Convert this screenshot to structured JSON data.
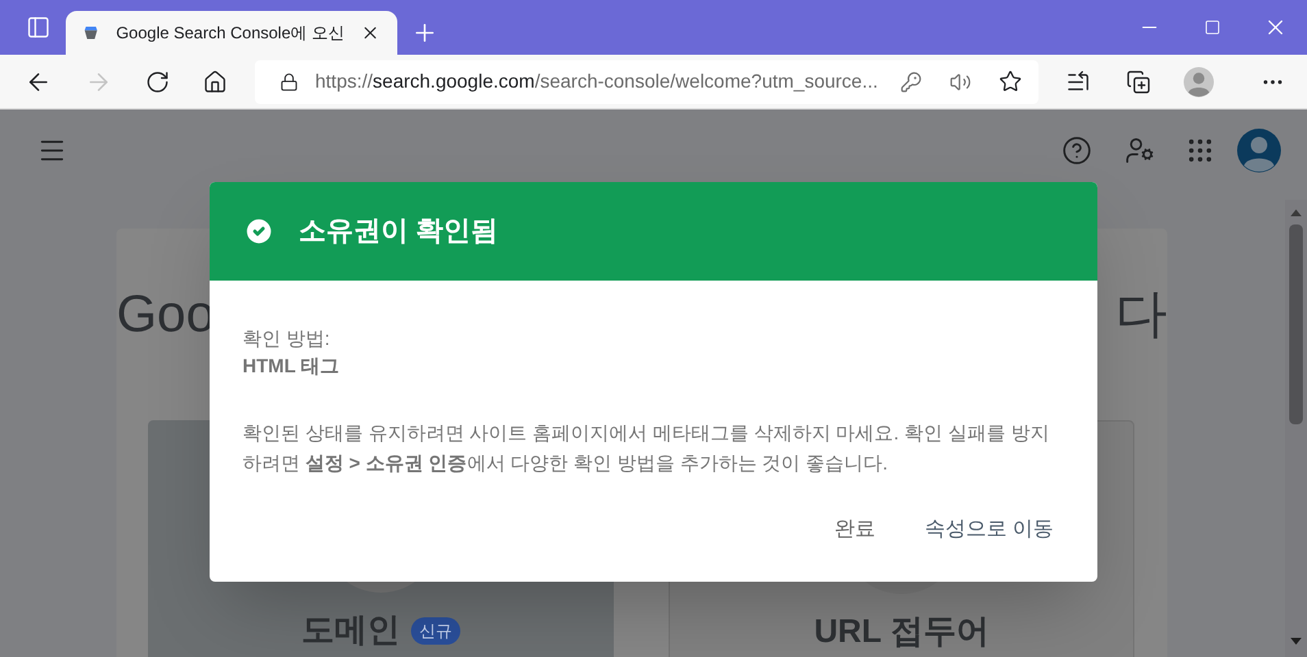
{
  "browser": {
    "tab": {
      "title": "Google Search Console에 오신",
      "selected": true
    },
    "address": {
      "scheme": "https://",
      "host": "search.google.com",
      "path": "/search-console/welcome?utm_source..."
    }
  },
  "page": {
    "heading_left": "Goo",
    "heading_right": "다",
    "cards": [
      {
        "title": "도메인",
        "badge": "신규"
      },
      {
        "title": "URL 접두어"
      }
    ]
  },
  "dialog": {
    "title": "소유권이 확인됨",
    "method_label": "확인 방법:",
    "method_value": "HTML 태그",
    "message": "확인된 상태를 유지하려면 사이트 홈페이지에서 메타태그를 삭제하지 마세요. 확인 실패를 방지하려면 **설정 > 소유권 인증**에서 다양한 확인 방법을 추가하는 것이 좋습니다.",
    "buttons": [
      "완료",
      "속성으로 이동"
    ]
  }
}
